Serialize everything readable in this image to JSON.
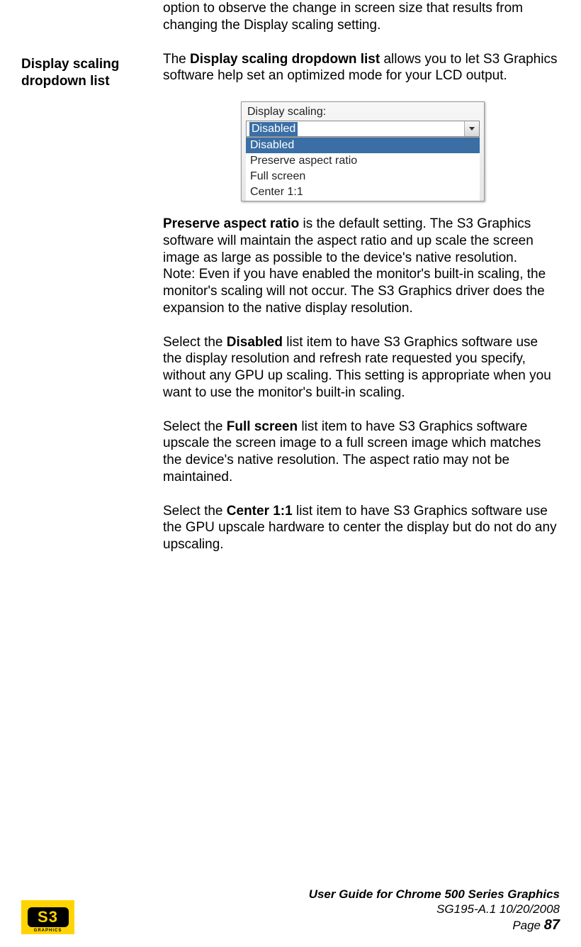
{
  "intro_para": "option to observe the change in screen size that results from changing the Display scaling setting.",
  "sidebar_heading": "Display scaling dropdown list",
  "p1_a": "The ",
  "p1_b": "Display scaling dropdown list",
  "p1_c": " allows you to let S3 Graphics software help set an optimized mode for your LCD output.",
  "dropdown": {
    "label": "Display scaling:",
    "selected": "Disabled",
    "items": [
      "Disabled",
      "Preserve aspect ratio",
      "Full screen",
      "Center 1:1"
    ]
  },
  "p2_a": "Preserve aspect ratio",
  "p2_b": " is the default setting. The S3 Graphics software will maintain the aspect ratio and up scale the screen image as large as possible to the device's native resolution.",
  "p2_note": "Note: Even if you have enabled the monitor's built-in scaling, the monitor's scaling will not occur. The S3 Graphics driver does the expansion to the native display resolution.",
  "p3_a": "Select the ",
  "p3_b": "Disabled",
  "p3_c": " list item to have S3 Graphics software use the display resolution and refresh rate requested you specify, without any GPU up scaling. This setting is appropriate when you want to use the monitor's built-in scaling.",
  "p4_a": "Select the ",
  "p4_b": "Full screen",
  "p4_c": " list item to have S3 Graphics software upscale the screen image to a full screen image which matches the device's native resolution. The aspect ratio may not be maintained.",
  "p5_a": "Select the ",
  "p5_b": "Center 1:1",
  "p5_c": " list item to have S3 Graphics software use the GPU upscale hardware to center the display but do not do any upscaling.",
  "footer": {
    "title": "User Guide for Chrome 500 Series Graphics",
    "docid": "SG195-A.1   10/20/2008",
    "page_label": "Page ",
    "page_num": "87",
    "logo_text": "S3",
    "logo_sub": "GRAPHICS"
  }
}
